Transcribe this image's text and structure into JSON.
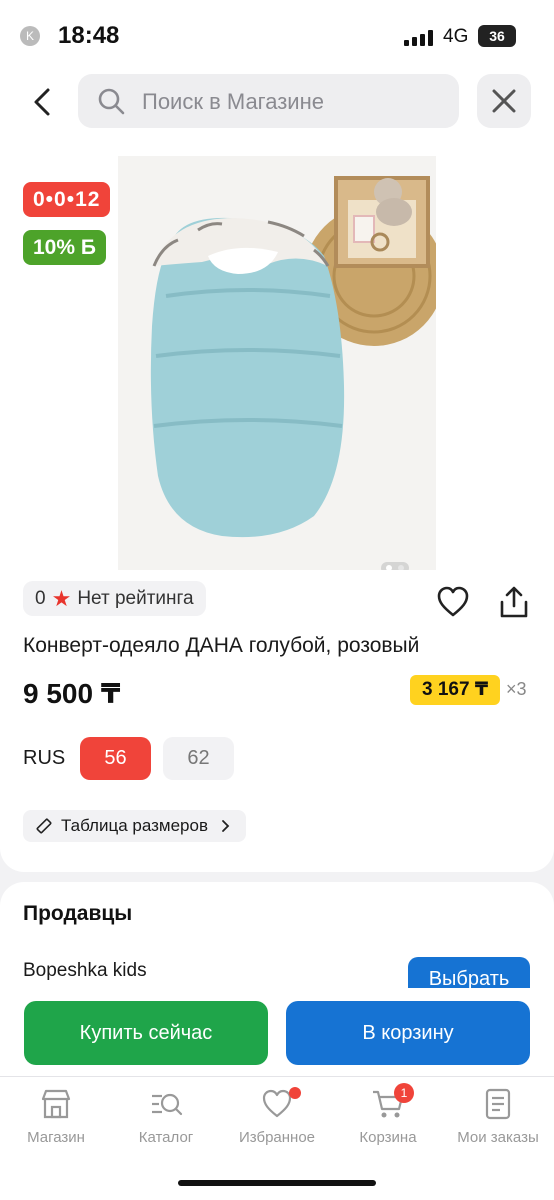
{
  "status_bar": {
    "time": "18:48",
    "network": "4G",
    "battery": "36",
    "app_mark": "K"
  },
  "header": {
    "search_placeholder": "Поиск в Магазине"
  },
  "product": {
    "timer_badge": "0•0•12",
    "bonus_badge": "10% Б",
    "photo_dots": 2,
    "rating_value": "0",
    "rating_text": "Нет рейтинга",
    "title": "Конверт-одеяло ДАНА голубой, розовый",
    "price": "9 500 ₸",
    "credit_price": "3 167 ₸",
    "credit_months": "×3",
    "size_system": "RUS",
    "sizes": [
      "56",
      "62"
    ],
    "selected_size": "56",
    "size_table_label": "Таблица размеров"
  },
  "sellers": {
    "heading": "Продавцы",
    "seller_name": "Bopeshka kids",
    "select_label": "Выбрать"
  },
  "actions": {
    "buy_now": "Купить сейчас",
    "add_to_cart": "В корзину"
  },
  "tabbar": {
    "items": [
      {
        "label": "Магазин",
        "icon": "store-icon"
      },
      {
        "label": "Каталог",
        "icon": "catalog-icon"
      },
      {
        "label": "Избранное",
        "icon": "heart-icon"
      },
      {
        "label": "Корзина",
        "icon": "cart-icon",
        "count": "1"
      },
      {
        "label": "Мои заказы",
        "icon": "orders-icon"
      }
    ]
  },
  "colors": {
    "accent_red": "#f0443a",
    "accent_green": "#1fa54a",
    "accent_blue": "#1673d3",
    "credit_yellow": "#ffd21f"
  }
}
